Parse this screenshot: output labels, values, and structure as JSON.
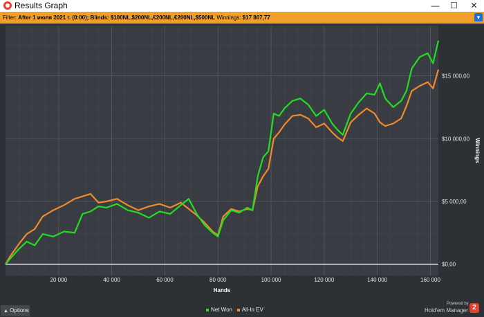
{
  "window": {
    "title": "Results Graph",
    "controls": {
      "minimize": "—",
      "maximize": "☐",
      "close": "✕"
    },
    "icon": "app-logo-icon"
  },
  "filter": {
    "label": "Filter:",
    "value": "After 1 июля 2021 г. (0:00); Blinds: $100NL,$200NL,€200NL,€200NL,$500NL",
    "winnings_label": "Winnings:",
    "winnings_value": "$17 807,77"
  },
  "options_button": {
    "label": "Options"
  },
  "legend": [
    {
      "label": "Net Won",
      "color": "#22dd22"
    },
    {
      "label": "All-In EV",
      "color": "#f08a2c"
    }
  ],
  "branding": {
    "powered_by": "Powered by",
    "product": "Hold'em Manager",
    "logo": "2"
  },
  "chart_data": {
    "type": "line",
    "xlabel": "Hands",
    "ylabel": "Winnings",
    "xlim": [
      0,
      163000
    ],
    "ylim": [
      -900,
      19000
    ],
    "x_ticks": [
      20000,
      40000,
      60000,
      80000,
      100000,
      120000,
      140000,
      160000
    ],
    "x_tick_labels": [
      "20 000",
      "40 000",
      "60 000",
      "80 000",
      "100 000",
      "120 000",
      "140 000",
      "160 000"
    ],
    "y_ticks": [
      0,
      5000,
      10000,
      15000
    ],
    "y_tick_labels": [
      "$0,00",
      "$5 000,00",
      "$10 000,00",
      "$15 000,00"
    ],
    "grid": true,
    "legend_position": "bottom-center",
    "x": [
      0,
      2000,
      5000,
      8000,
      11000,
      14000,
      18000,
      22000,
      26000,
      29000,
      32000,
      35000,
      38000,
      42000,
      46000,
      50000,
      54000,
      58000,
      62000,
      66000,
      69000,
      72000,
      75000,
      78000,
      80000,
      82000,
      85000,
      88000,
      91000,
      93000,
      95000,
      97000,
      99000,
      101000,
      103000,
      105000,
      108000,
      111000,
      114000,
      117000,
      120000,
      123000,
      125000,
      127000,
      130000,
      133000,
      136000,
      139000,
      141000,
      143000,
      146000,
      149000,
      151000,
      153000,
      156000,
      159000,
      161000,
      163000
    ],
    "series": [
      {
        "name": "Net Won",
        "color": "#22dd22",
        "values": [
          0,
          500,
          1200,
          1800,
          1500,
          2400,
          2200,
          2600,
          2500,
          4000,
          4200,
          4600,
          4500,
          4800,
          4300,
          4100,
          3700,
          4200,
          4000,
          4700,
          5200,
          4000,
          3100,
          2500,
          2200,
          3500,
          4300,
          4100,
          4500,
          4300,
          7000,
          8500,
          9000,
          12000,
          11800,
          12400,
          13000,
          13200,
          12700,
          11800,
          12300,
          11200,
          10700,
          10300,
          12000,
          12900,
          13600,
          13500,
          14400,
          13200,
          12500,
          13000,
          13800,
          15600,
          16500,
          16800,
          16000,
          17800
        ]
      },
      {
        "name": "All-In EV",
        "color": "#f08a2c",
        "values": [
          0,
          700,
          1600,
          2400,
          2800,
          3800,
          4300,
          4700,
          5200,
          5400,
          5600,
          4900,
          5000,
          5200,
          4700,
          4300,
          4600,
          4800,
          4500,
          4900,
          4400,
          3900,
          3300,
          2600,
          2300,
          3800,
          4400,
          4200,
          4400,
          4300,
          6200,
          7000,
          7600,
          10000,
          10500,
          11100,
          11800,
          11900,
          11600,
          10900,
          11200,
          10500,
          10100,
          9800,
          11300,
          11900,
          12400,
          12000,
          11300,
          11000,
          11200,
          11600,
          12600,
          13800,
          14200,
          14500,
          14000,
          15500
        ]
      }
    ]
  }
}
